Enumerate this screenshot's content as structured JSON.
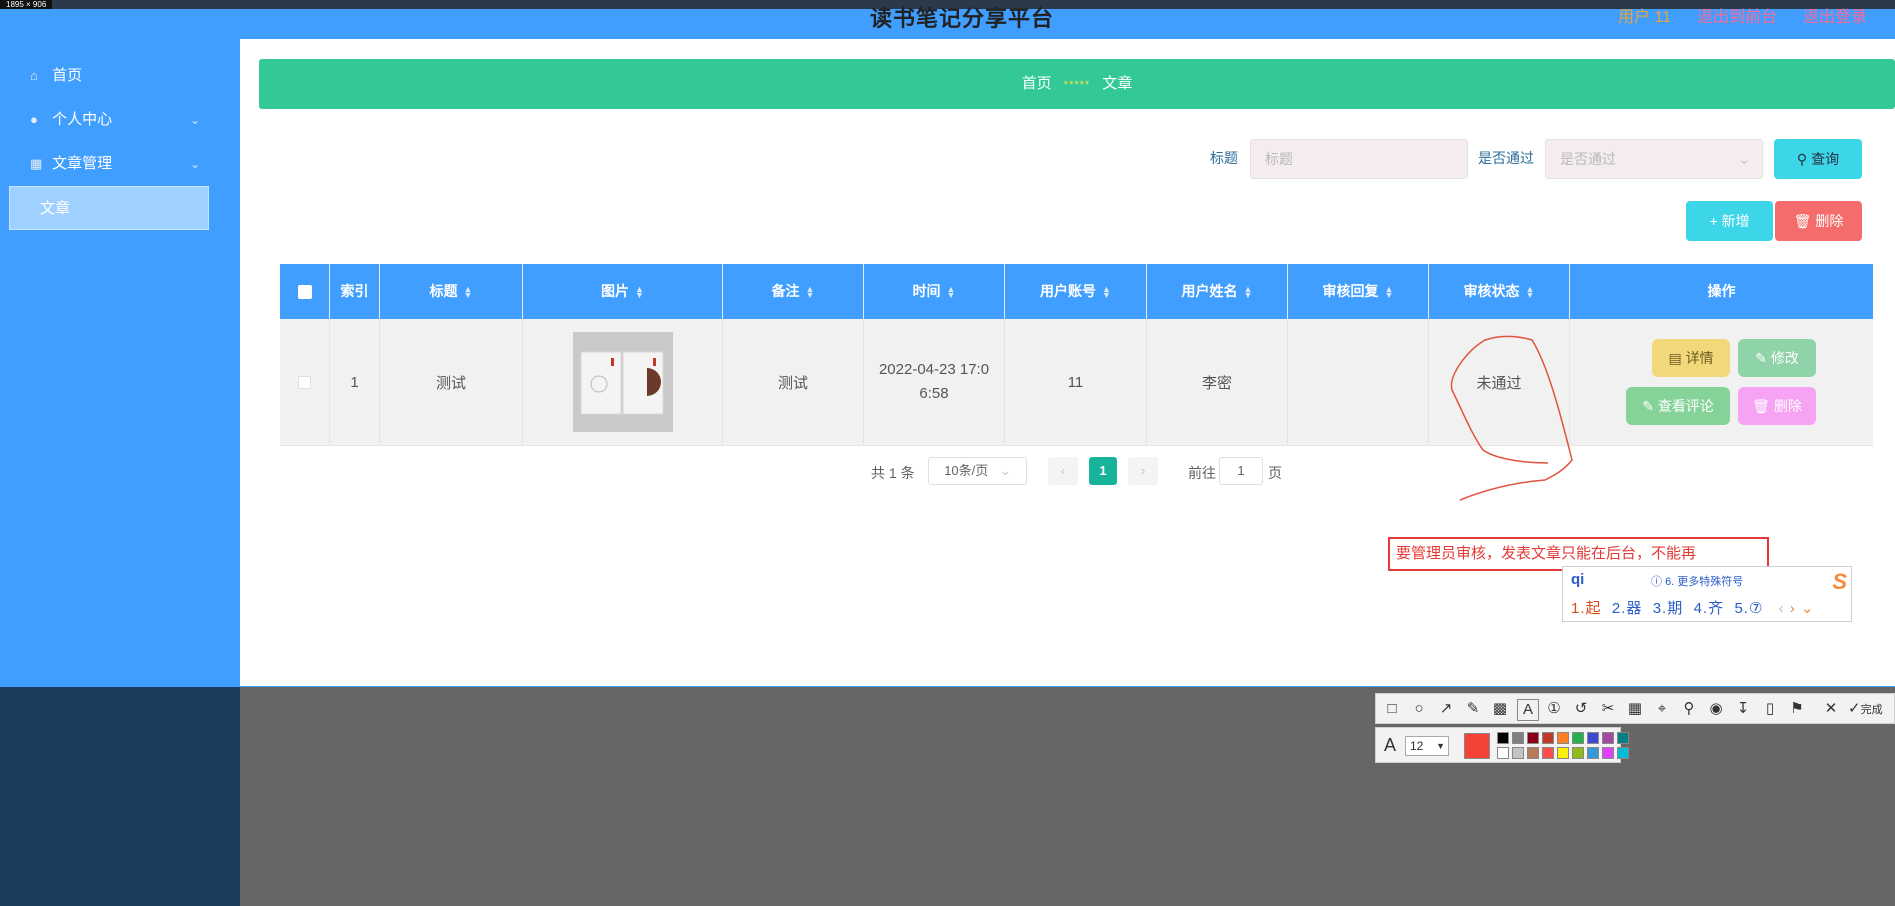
{
  "header": {
    "title": "读书笔记分享平台",
    "user_label": "用户 11",
    "exit_admin": "退出到前台",
    "logout": "退出登录",
    "size_badge": "1895 × 906"
  },
  "sidebar": {
    "items": [
      {
        "label": "首页",
        "icon": "home-icon"
      },
      {
        "label": "个人中心",
        "icon": "user-icon"
      },
      {
        "label": "文章管理",
        "icon": "clipboard-icon"
      }
    ],
    "active_sub": "文章"
  },
  "breadcrumb": {
    "home": "首页",
    "separator": "*****",
    "current": "文章"
  },
  "search": {
    "title_label": "标题",
    "title_placeholder": "标题",
    "passed_label": "是否通过",
    "passed_placeholder": "是否通过",
    "query_btn": "查询"
  },
  "actions": {
    "add": "新增",
    "delete": "删除"
  },
  "table": {
    "headers": [
      "索引",
      "标题",
      "图片",
      "备注",
      "时间",
      "用户账号",
      "用户姓名",
      "审核回复",
      "审核状态",
      "操作"
    ],
    "rows": [
      {
        "index": "1",
        "title": "测试",
        "note": "测试",
        "time_line1": "2022-04-23 17:0",
        "time_line2": "6:58",
        "account": "11",
        "name": "李密",
        "reply": "",
        "status": "未通过",
        "buttons": {
          "detail": "详情",
          "edit": "修改",
          "comments": "查看评论",
          "delete": "删除"
        }
      }
    ]
  },
  "pager": {
    "total": "共 1 条",
    "page_size": "10条/页",
    "current": "1",
    "goto_label": "前往",
    "goto_value": "1",
    "page_unit": "页"
  },
  "annotation": {
    "text": "要管理员审核，发表文章只能在后台，不能再",
    "ime_pinyin": "qi",
    "ime_hint": "6. 更多特殊符号",
    "ime_candidates": [
      "1.起",
      "2.器",
      "3.期",
      "4.齐",
      "5.⑦"
    ]
  },
  "toolbar": {
    "font_size": "12",
    "done_label": "完成",
    "selected_color": "#f44336",
    "palette": [
      "#000000",
      "#7f7f7f",
      "#880015",
      "#c0392b",
      "#ff7f27",
      "#22b14c",
      "#3f48cc",
      "#a349a4",
      "#008080",
      "#ffffff",
      "#c3c3c3",
      "#b97a57",
      "#ff4d4d",
      "#fff200",
      "#8fbc1a",
      "#3498db",
      "#e040fb",
      "#00bcd4"
    ]
  },
  "colors": {
    "primary": "#409eff",
    "breadcrumb_bg": "#32c897",
    "query_btn": "#3dd5e8",
    "delete_btn": "#f56c6c",
    "detail_btn": "#f2d87a",
    "edit_btn": "#8fd3a8",
    "comments_btn": "#86d39a",
    "row_delete_btn": "#f5a3f2"
  }
}
